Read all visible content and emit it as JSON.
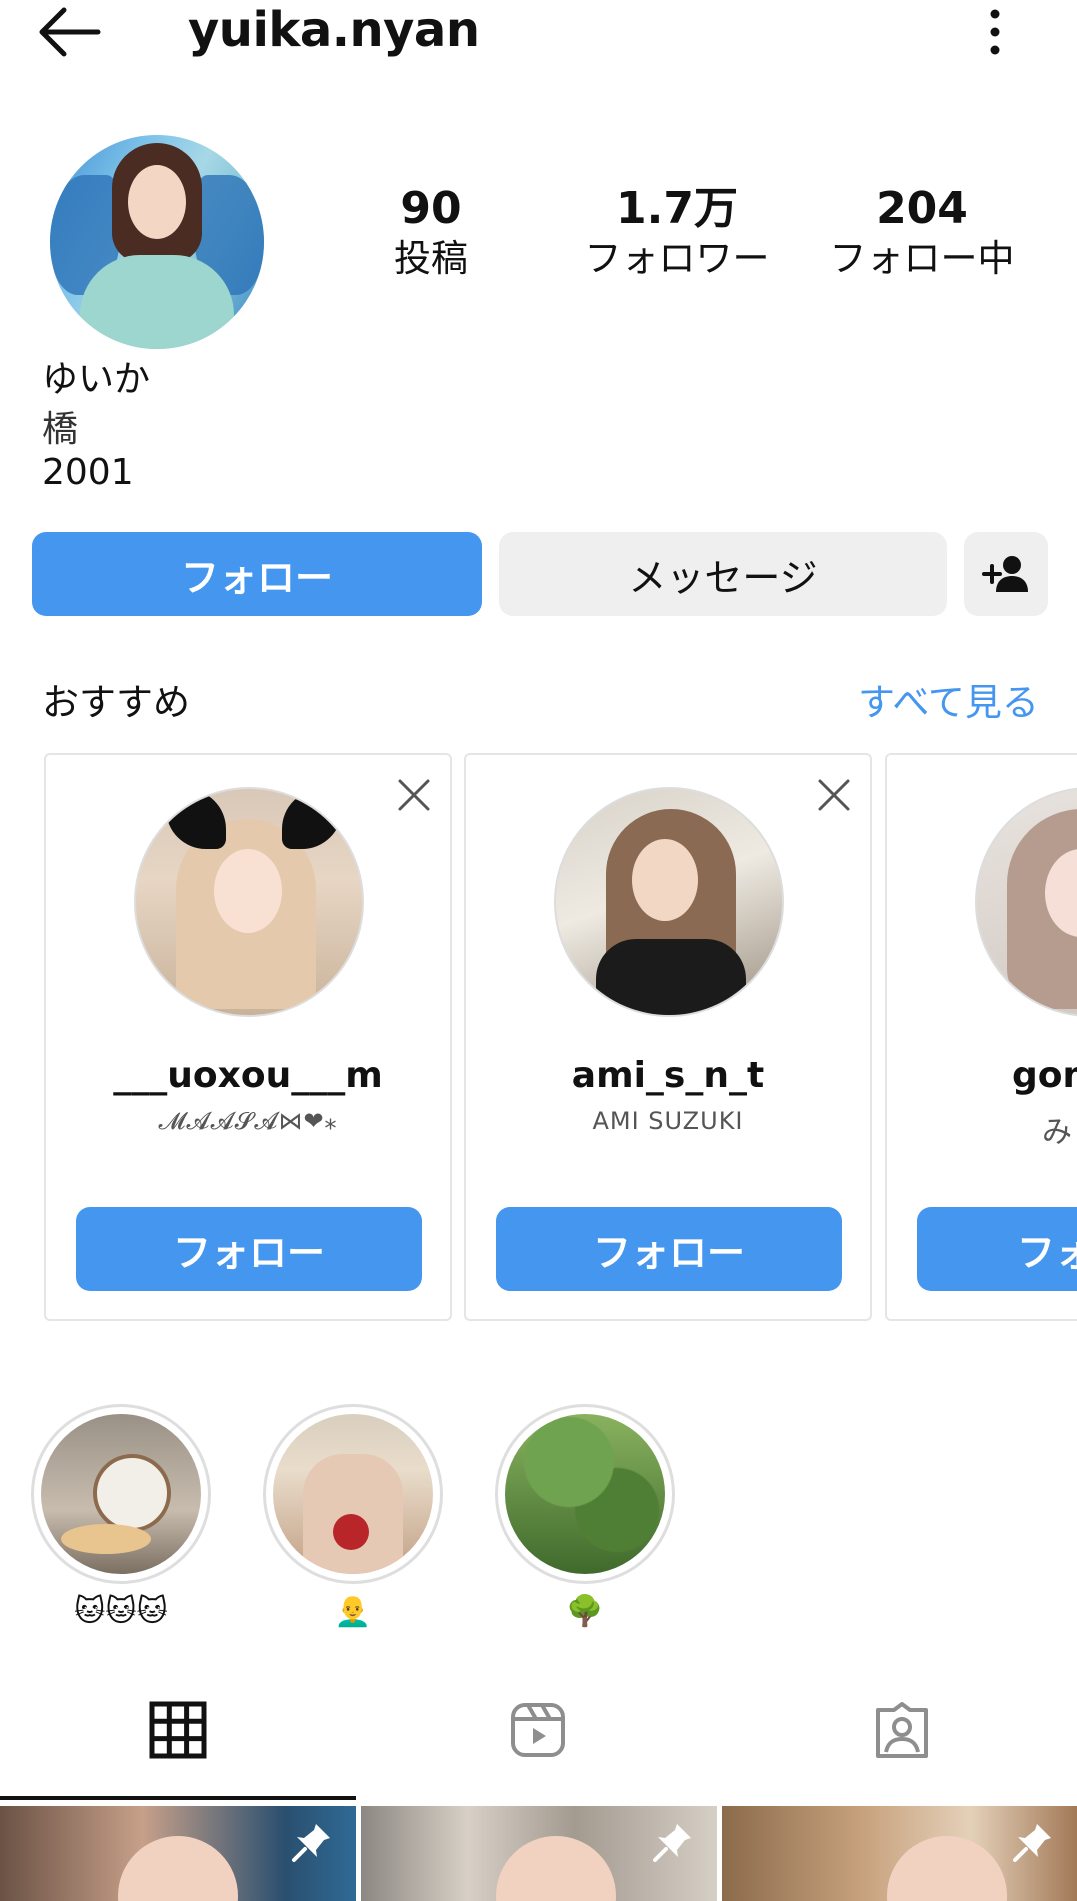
{
  "header": {
    "username": "yuika.nyan"
  },
  "profile": {
    "stats": [
      {
        "value": "90",
        "label": "投稿"
      },
      {
        "value": "1.7万",
        "label": "フォロワー"
      },
      {
        "value": "204",
        "label": "フォロー中"
      }
    ],
    "display_name": "ゆいか",
    "bio_line1": "橋",
    "bio_line2": "2001"
  },
  "actions": {
    "follow_label": "フォロー",
    "message_label": "メッセージ"
  },
  "suggestions": {
    "title": "おすすめ",
    "see_all": "すべて見る",
    "cards": [
      {
        "username": "___uoxou___m",
        "subtitle": "𝓜𝓐𝓐𝓢𝓐⋈❤︎⁎",
        "follow_label": "フォロー"
      },
      {
        "username": "ami_s_n_t",
        "subtitle": "AMI SUZUKI",
        "follow_label": "フォロー"
      },
      {
        "username": "gom",
        "subtitle": "み",
        "follow_label": "フォ"
      }
    ]
  },
  "highlights": [
    {
      "label": "🐱🐱🐱"
    },
    {
      "label": "👨‍🦲"
    },
    {
      "label": "🌳"
    }
  ],
  "tabs": [
    "grid",
    "reels",
    "tagged"
  ],
  "colors": {
    "accent": "#4596ef",
    "button_gray": "#efefef"
  }
}
